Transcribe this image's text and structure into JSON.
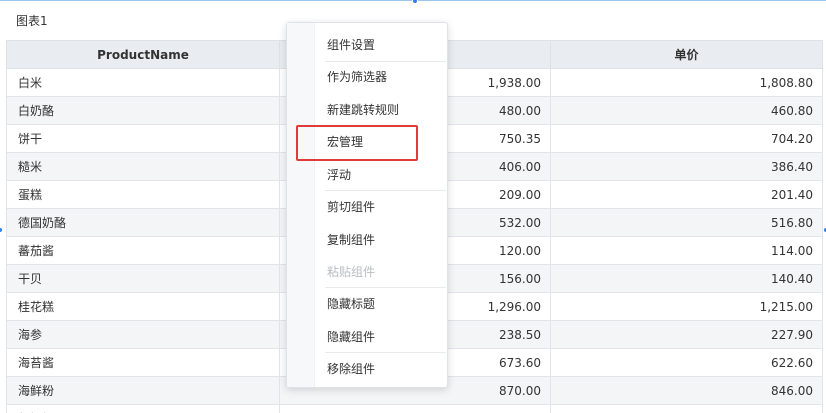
{
  "widget": {
    "title": "图表1"
  },
  "table": {
    "columns": [
      "ProductName",
      "",
      "单价"
    ],
    "rows": [
      {
        "name": "白米",
        "v1": "1,938.00",
        "v2": "1,808.80"
      },
      {
        "name": "白奶酪",
        "v1": "480.00",
        "v2": "460.80"
      },
      {
        "name": "饼干",
        "v1": "750.35",
        "v2": "704.20"
      },
      {
        "name": "糙米",
        "v1": "406.00",
        "v2": "386.40"
      },
      {
        "name": "蛋糕",
        "v1": "209.00",
        "v2": "201.40"
      },
      {
        "name": "德国奶酪",
        "v1": "532.00",
        "v2": "516.80"
      },
      {
        "name": "蕃茄酱",
        "v1": "120.00",
        "v2": "114.00"
      },
      {
        "name": "干贝",
        "v1": "156.00",
        "v2": "140.40"
      },
      {
        "name": "桂花糕",
        "v1": "1,296.00",
        "v2": "1,215.00"
      },
      {
        "name": "海参",
        "v1": "238.50",
        "v2": "227.90"
      },
      {
        "name": "海苔酱",
        "v1": "673.60",
        "v2": "622.60"
      },
      {
        "name": "海鲜粉",
        "v1": "870.00",
        "v2": "846.00"
      },
      {
        "name": "胡椒粉",
        "v1": "",
        "v2": ""
      }
    ]
  },
  "context_menu": {
    "items": [
      {
        "label": "组件设置",
        "disabled": false
      },
      {
        "label": "作为筛选器",
        "disabled": false
      },
      {
        "label": "新建跳转规则",
        "disabled": false
      },
      {
        "label": "宏管理",
        "disabled": false
      },
      {
        "label": "浮动",
        "disabled": false
      },
      {
        "label": "剪切组件",
        "disabled": false
      },
      {
        "label": "复制组件",
        "disabled": false
      },
      {
        "label": "粘贴组件",
        "disabled": true
      },
      {
        "label": "隐藏标题",
        "disabled": false
      },
      {
        "label": "隐藏组件",
        "disabled": false
      },
      {
        "label": "移除组件",
        "disabled": false
      }
    ]
  },
  "colors": {
    "highlight": "#e03a3a",
    "selection_handle": "#2f80ed",
    "header_bg": "#e9edf1"
  }
}
